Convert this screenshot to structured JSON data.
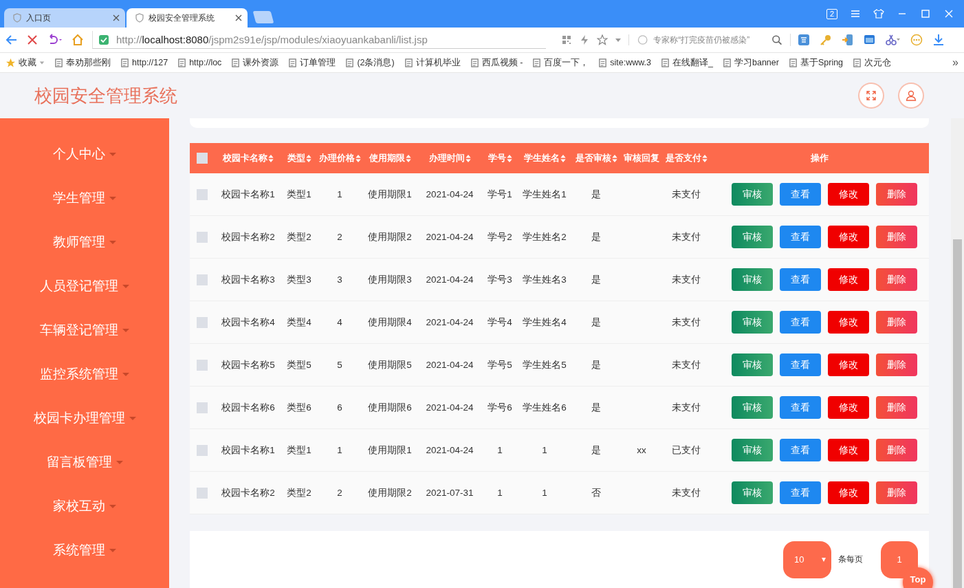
{
  "browser": {
    "tabs": [
      {
        "title": "入口页",
        "selected": false
      },
      {
        "title": "校园安全管理系统",
        "selected": true
      }
    ],
    "tab_count": "2",
    "address": {
      "scheme": "http://",
      "host": "localhost:8080",
      "path": "/jspm2s91e/jsp/modules/xiaoyuankabanli/list.jsp"
    },
    "search": {
      "placeholder": "专家称“打完疫苗仍被感染”"
    },
    "bookmarks": [
      {
        "label": "收藏",
        "kind": "favorites"
      },
      {
        "label": "奉劝那些刚",
        "kind": "link"
      },
      {
        "label": "http://127",
        "kind": "link"
      },
      {
        "label": "http://loc",
        "kind": "link"
      },
      {
        "label": "课外资源",
        "kind": "link"
      },
      {
        "label": "订单管理",
        "kind": "link"
      },
      {
        "label": "(2条消息)",
        "kind": "link"
      },
      {
        "label": "计算机毕业",
        "kind": "link"
      },
      {
        "label": "西瓜视频 -",
        "kind": "link"
      },
      {
        "label": "百度一下，",
        "kind": "link"
      },
      {
        "label": "site:www.3",
        "kind": "link"
      },
      {
        "label": "在线翻译_",
        "kind": "link"
      },
      {
        "label": "学习banner",
        "kind": "link"
      },
      {
        "label": "基于Spring",
        "kind": "link"
      },
      {
        "label": "次元仓",
        "kind": "link"
      }
    ],
    "bookmarks_more": "»"
  },
  "app": {
    "title": "校园安全管理系统"
  },
  "sidebar": {
    "items": [
      {
        "label": "个人中心"
      },
      {
        "label": "学生管理"
      },
      {
        "label": "教师管理"
      },
      {
        "label": "人员登记管理"
      },
      {
        "label": "车辆登记管理"
      },
      {
        "label": "监控系统管理"
      },
      {
        "label": "校园卡办理管理"
      },
      {
        "label": "留言板管理"
      },
      {
        "label": "家校互动"
      },
      {
        "label": "系统管理"
      }
    ]
  },
  "table": {
    "all_checked": false,
    "columns": [
      {
        "label": "校园卡名称",
        "sortable": true
      },
      {
        "label": "类型",
        "sortable": true
      },
      {
        "label": "办理价格",
        "sortable": true
      },
      {
        "label": "使用期限",
        "sortable": true
      },
      {
        "label": "办理时间",
        "sortable": true
      },
      {
        "label": "学号",
        "sortable": true
      },
      {
        "label": "学生姓名",
        "sortable": true
      },
      {
        "label": "是否审核",
        "sortable": true
      },
      {
        "label": "审核回复",
        "sortable": false
      },
      {
        "label": "是否支付",
        "sortable": true
      },
      {
        "label": "操作",
        "sortable": false
      }
    ],
    "rows": [
      {
        "checked": false,
        "cells": [
          "校园卡名称1",
          "类型1",
          "1",
          "使用期限1",
          "2021-04-24",
          "学号1",
          "学生姓名1",
          "是",
          "",
          "未支付"
        ],
        "actions": [
          "审核",
          "查看",
          "修改",
          "删除"
        ]
      },
      {
        "checked": false,
        "cells": [
          "校园卡名称2",
          "类型2",
          "2",
          "使用期限2",
          "2021-04-24",
          "学号2",
          "学生姓名2",
          "是",
          "",
          "未支付"
        ],
        "actions": [
          "审核",
          "查看",
          "修改",
          "删除"
        ]
      },
      {
        "checked": false,
        "cells": [
          "校园卡名称3",
          "类型3",
          "3",
          "使用期限3",
          "2021-04-24",
          "学号3",
          "学生姓名3",
          "是",
          "",
          "未支付"
        ],
        "actions": [
          "审核",
          "查看",
          "修改",
          "删除"
        ]
      },
      {
        "checked": false,
        "cells": [
          "校园卡名称4",
          "类型4",
          "4",
          "使用期限4",
          "2021-04-24",
          "学号4",
          "学生姓名4",
          "是",
          "",
          "未支付"
        ],
        "actions": [
          "审核",
          "查看",
          "修改",
          "删除"
        ]
      },
      {
        "checked": false,
        "cells": [
          "校园卡名称5",
          "类型5",
          "5",
          "使用期限5",
          "2021-04-24",
          "学号5",
          "学生姓名5",
          "是",
          "",
          "未支付"
        ],
        "actions": [
          "审核",
          "查看",
          "修改",
          "删除"
        ]
      },
      {
        "checked": false,
        "cells": [
          "校园卡名称6",
          "类型6",
          "6",
          "使用期限6",
          "2021-04-24",
          "学号6",
          "学生姓名6",
          "是",
          "",
          "未支付"
        ],
        "actions": [
          "审核",
          "查看",
          "修改",
          "删除"
        ]
      },
      {
        "checked": false,
        "cells": [
          "校园卡名称1",
          "类型1",
          "1",
          "使用期限1",
          "2021-04-24",
          "1",
          "1",
          "是",
          "xx",
          "已支付"
        ],
        "actions": [
          "审核",
          "查看",
          "修改",
          "删除"
        ]
      },
      {
        "checked": false,
        "cells": [
          "校园卡名称2",
          "类型2",
          "2",
          "使用期限2",
          "2021-07-31",
          "1",
          "1",
          "否",
          "",
          "未支付"
        ],
        "actions": [
          "审核",
          "查看",
          "修改",
          "删除"
        ]
      }
    ]
  },
  "pagination": {
    "page_size": "10",
    "page_size_label": "条每页",
    "current_page": "1",
    "top_button": "Top"
  }
}
